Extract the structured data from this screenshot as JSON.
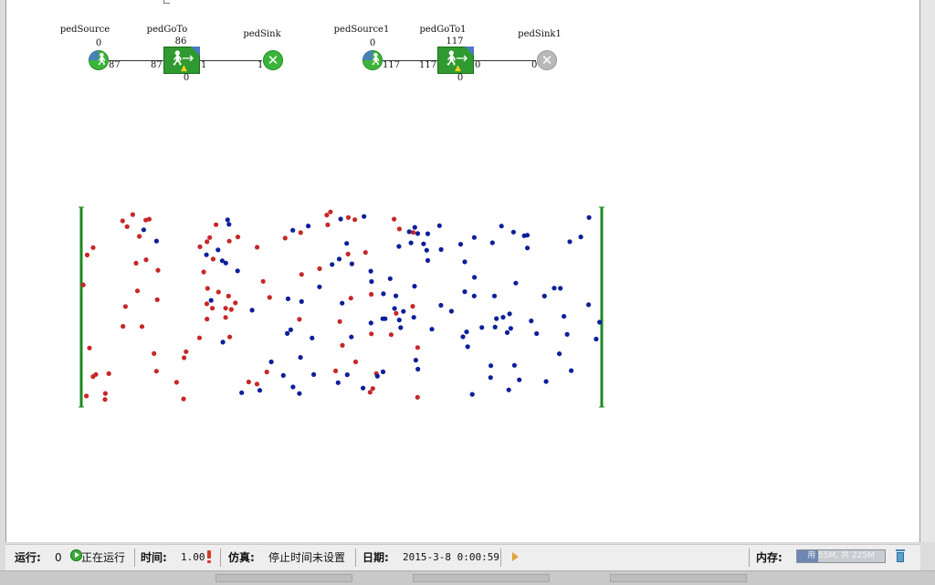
{
  "blocks": [
    {
      "label": "pedSource",
      "top_count": "0",
      "out_count": "87"
    },
    {
      "label": "pedGoTo",
      "top_count": "86",
      "in_count": "87",
      "out_count": "1",
      "bottom_count": "0"
    },
    {
      "label": "pedSink",
      "in_count": "1"
    },
    {
      "label": "pedSource1",
      "top_count": "0",
      "out_count": "117"
    },
    {
      "label": "pedGoTo1",
      "top_count": "117",
      "in_count": "117",
      "out_count": "0",
      "bottom_count": "0"
    },
    {
      "label": "pedSink1",
      "in_count": "0"
    }
  ],
  "crowd": {
    "red_color": "#c62828",
    "blue_color": "#0d1f9a",
    "wall_color": "#1e8a1e"
  },
  "status_bar": {
    "run_label": "运行:",
    "run_count": "0",
    "run_state": "正在运行",
    "time_label": "时间:",
    "time_value": "1.00",
    "sim_label": "仿真:",
    "sim_value": "停止时间未设置",
    "date_label": "日期:",
    "date_value": "2015-3-8 0:00:59",
    "memory_label": "内存:",
    "memory_text": "用 55M, 共 225M",
    "memory_used_fraction": 0.244
  }
}
